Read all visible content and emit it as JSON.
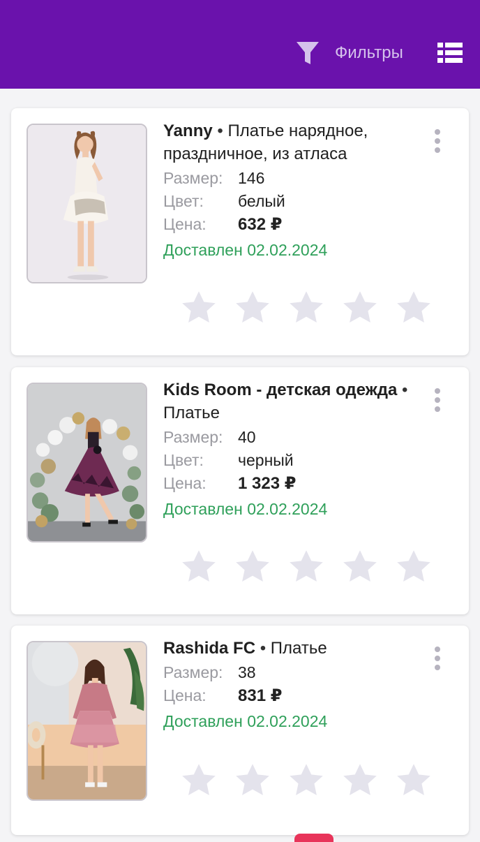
{
  "header": {
    "filters_label": "Фильтры",
    "filter_icon": "filter-funnel-icon",
    "view_icon": "list-view-icon",
    "background": "#6a12ac"
  },
  "labels": {
    "size": "Размер:",
    "color": "Цвет:",
    "price": "Цена:"
  },
  "orders": [
    {
      "brand": "Yanny",
      "separator": "•",
      "name": "Платье нарядное, праздничное, из атласа",
      "size": "146",
      "color": "белый",
      "price": "632 ₽",
      "status": "Доставлен 02.02.2024",
      "rating": 0,
      "rating_max": 5
    },
    {
      "brand": "Kids Room - детская одежда",
      "separator": "•",
      "name": "Платье",
      "size": "40",
      "color": "черный",
      "price": "1 323 ₽",
      "status": "Доставлен 02.02.2024",
      "rating": 0,
      "rating_max": 5
    },
    {
      "brand": "Rashida FC",
      "separator": "•",
      "name": "Платье",
      "size": "38",
      "price": "831 ₽",
      "status": "Доставлен 02.02.2024",
      "rating": 0,
      "rating_max": 5
    }
  ],
  "colors": {
    "delivered": "#2fa05a",
    "star_empty": "#e4e3ec",
    "label_grey": "#9a9aa0"
  }
}
